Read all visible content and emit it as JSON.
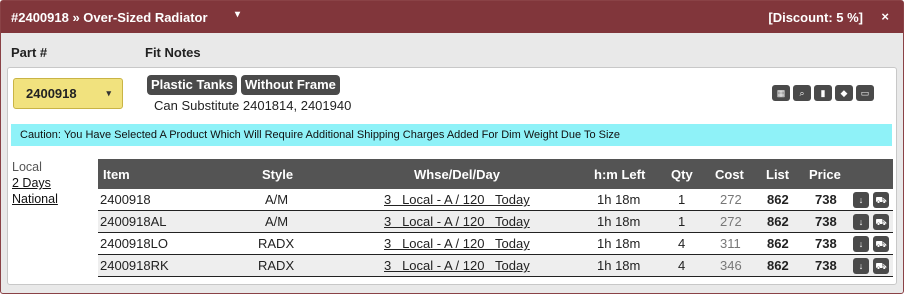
{
  "header": {
    "title": "#2400918 » Over-Sized Radiator",
    "caret": "▾",
    "discount": "[Discount: 5 %]",
    "close": "×"
  },
  "columns": {
    "part": "Part #",
    "fit_notes": "Fit Notes"
  },
  "part_select": {
    "value": "2400918",
    "caret": "▾"
  },
  "fit_notes": {
    "tags": [
      "Plastic Tanks",
      "Without Frame"
    ],
    "substitute": "Can Substitute 2401814, 2401940"
  },
  "tools": [
    "grid-icon",
    "search-icon",
    "chart-icon",
    "tag-icon",
    "comment-icon"
  ],
  "caution": "Caution: You Have Selected A Product Which Will Require Additional Shipping Charges Added For Dim Weight Due To Size",
  "locations": {
    "current": "Local",
    "links": [
      "2 Days",
      "National"
    ]
  },
  "table": {
    "headers": {
      "item": "Item",
      "style": "Style",
      "whse": "Whse/Del/Day",
      "hm": "h:m Left",
      "qty": "Qty",
      "cost": "Cost",
      "list": "List",
      "price": "Price"
    },
    "rows": [
      {
        "item": "2400918",
        "style": "A/M",
        "whse": "3   Local - A / 120   Today",
        "hm": "1h 18m",
        "qty": "1",
        "cost": "272",
        "list": "862",
        "price": "738"
      },
      {
        "item": "2400918AL",
        "style": "A/M",
        "whse": "3   Local - A / 120   Today",
        "hm": "1h 18m",
        "qty": "1",
        "cost": "272",
        "list": "862",
        "price": "738"
      },
      {
        "item": "2400918LO",
        "style": "RADX",
        "whse": "3   Local - A / 120   Today",
        "hm": "1h 18m",
        "qty": "4",
        "cost": "311",
        "list": "862",
        "price": "738"
      },
      {
        "item": "2400918RK",
        "style": "RADX",
        "whse": "3   Local - A / 120   Today",
        "hm": "1h 18m",
        "qty": "4",
        "cost": "346",
        "list": "862",
        "price": "738"
      }
    ],
    "row_icons": {
      "download": "↓",
      "cart": "🛒"
    }
  },
  "colors": {
    "titlebar": "#81363b",
    "caution": "#8ff2f8",
    "part_select": "#f1e27e",
    "table_header": "#545454"
  }
}
